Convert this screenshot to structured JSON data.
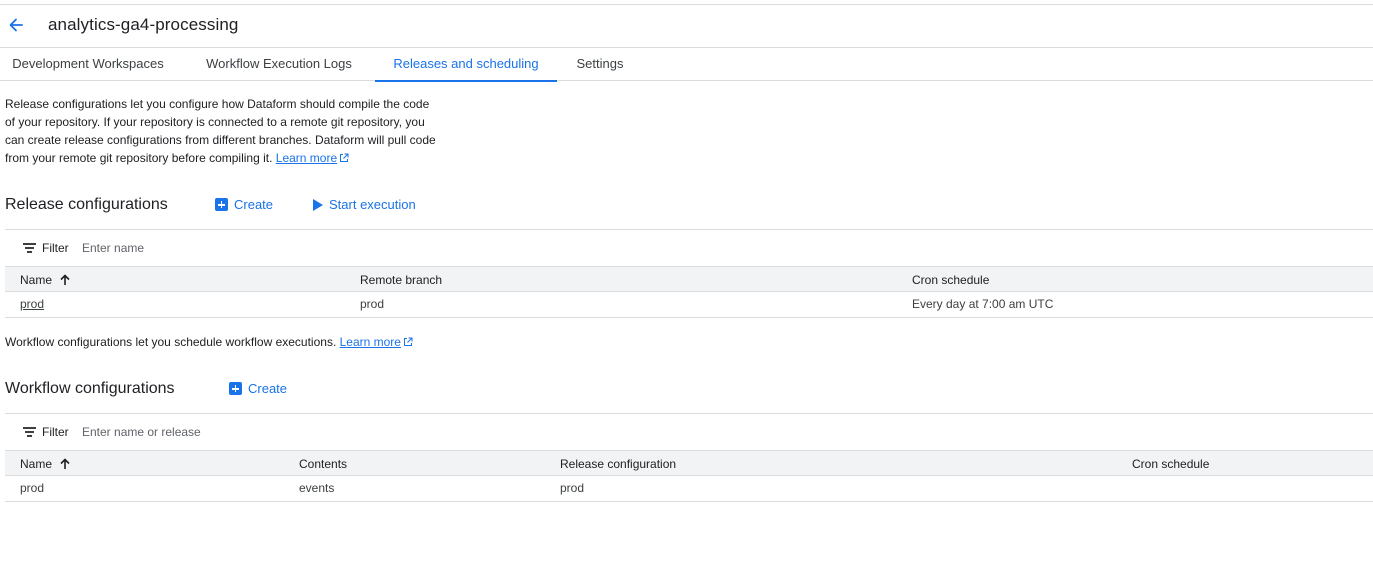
{
  "header": {
    "title": "analytics-ga4-processing"
  },
  "tabs": [
    {
      "label": "Development Workspaces"
    },
    {
      "label": "Workflow Execution Logs"
    },
    {
      "label": "Releases and scheduling"
    },
    {
      "label": "Settings"
    }
  ],
  "release": {
    "intro_lines": [
      "Release configurations let you configure how Dataform should compile the code",
      "of your repository. If your repository is connected to a remote git repository, you",
      "can create release configurations from different branches. Dataform will pull code",
      "from your remote git repository before compiling it. "
    ],
    "learn_more": "Learn more",
    "title": "Release configurations",
    "create_label": "Create",
    "start_label": "Start execution",
    "filter_label": "Filter",
    "filter_placeholder": "Enter name",
    "columns": [
      "Name",
      "Remote branch",
      "Cron schedule"
    ],
    "rows": [
      {
        "name": "prod",
        "branch": "prod",
        "cron": "Every day at 7:00 am UTC"
      }
    ]
  },
  "workflow": {
    "intro": "Workflow configurations let you schedule workflow executions. ",
    "learn_more": "Learn more",
    "title": "Workflow configurations",
    "create_label": "Create",
    "filter_label": "Filter",
    "filter_placeholder": "Enter name or release",
    "columns": [
      "Name",
      "Contents",
      "Release configuration",
      "Cron schedule"
    ],
    "rows": [
      {
        "name": "prod",
        "contents": "events",
        "release": "prod",
        "cron": ""
      }
    ]
  },
  "colors": {
    "accent": "#1a73e8",
    "border": "#dadce0",
    "header_bg": "#f1f3f4"
  }
}
